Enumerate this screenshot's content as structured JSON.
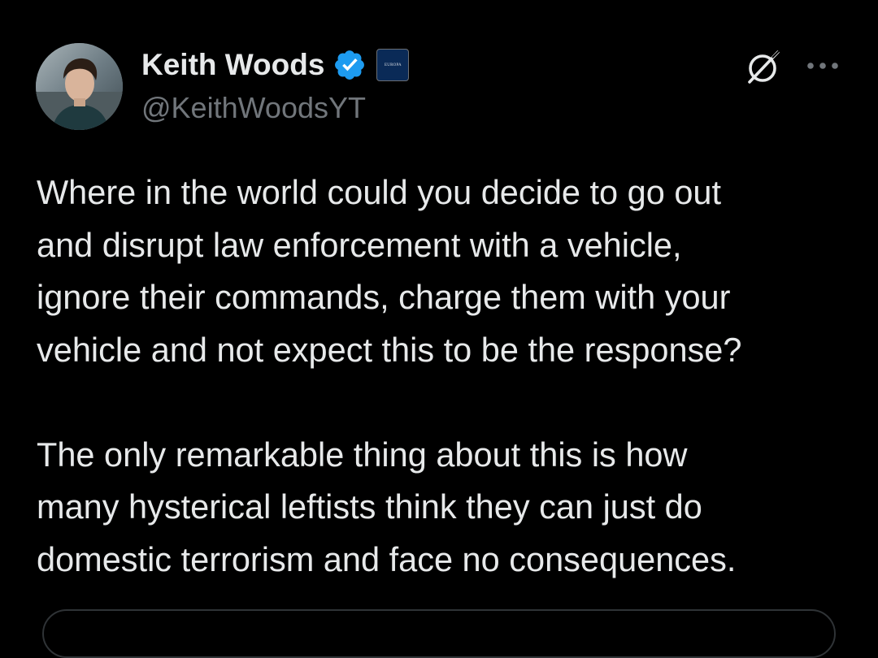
{
  "author": {
    "display_name": "Keith Woods",
    "handle": "@KeithWoodsYT",
    "verified_icon": "verified-badge-icon",
    "affiliate_badge_text": "EUROPA",
    "avatar_icon": "avatar"
  },
  "header_actions": {
    "grok_icon": "grok-icon",
    "more_icon": "more-horizontal-icon"
  },
  "tweet": {
    "lines": [
      "Where in the world could you decide to go out",
      "and disrupt law enforcement with a vehicle,",
      "ignore their commands, charge them with your",
      "vehicle and not expect this to be the response?",
      "",
      "The only remarkable thing about this is how",
      "many hysterical leftists think they can just do",
      "domestic terrorism and face no consequences."
    ]
  },
  "colors": {
    "background": "#000000",
    "primary_text": "#e7e9ea",
    "secondary_text": "#71767b",
    "verified_blue": "#1d9bf0",
    "border": "#2f3336"
  }
}
